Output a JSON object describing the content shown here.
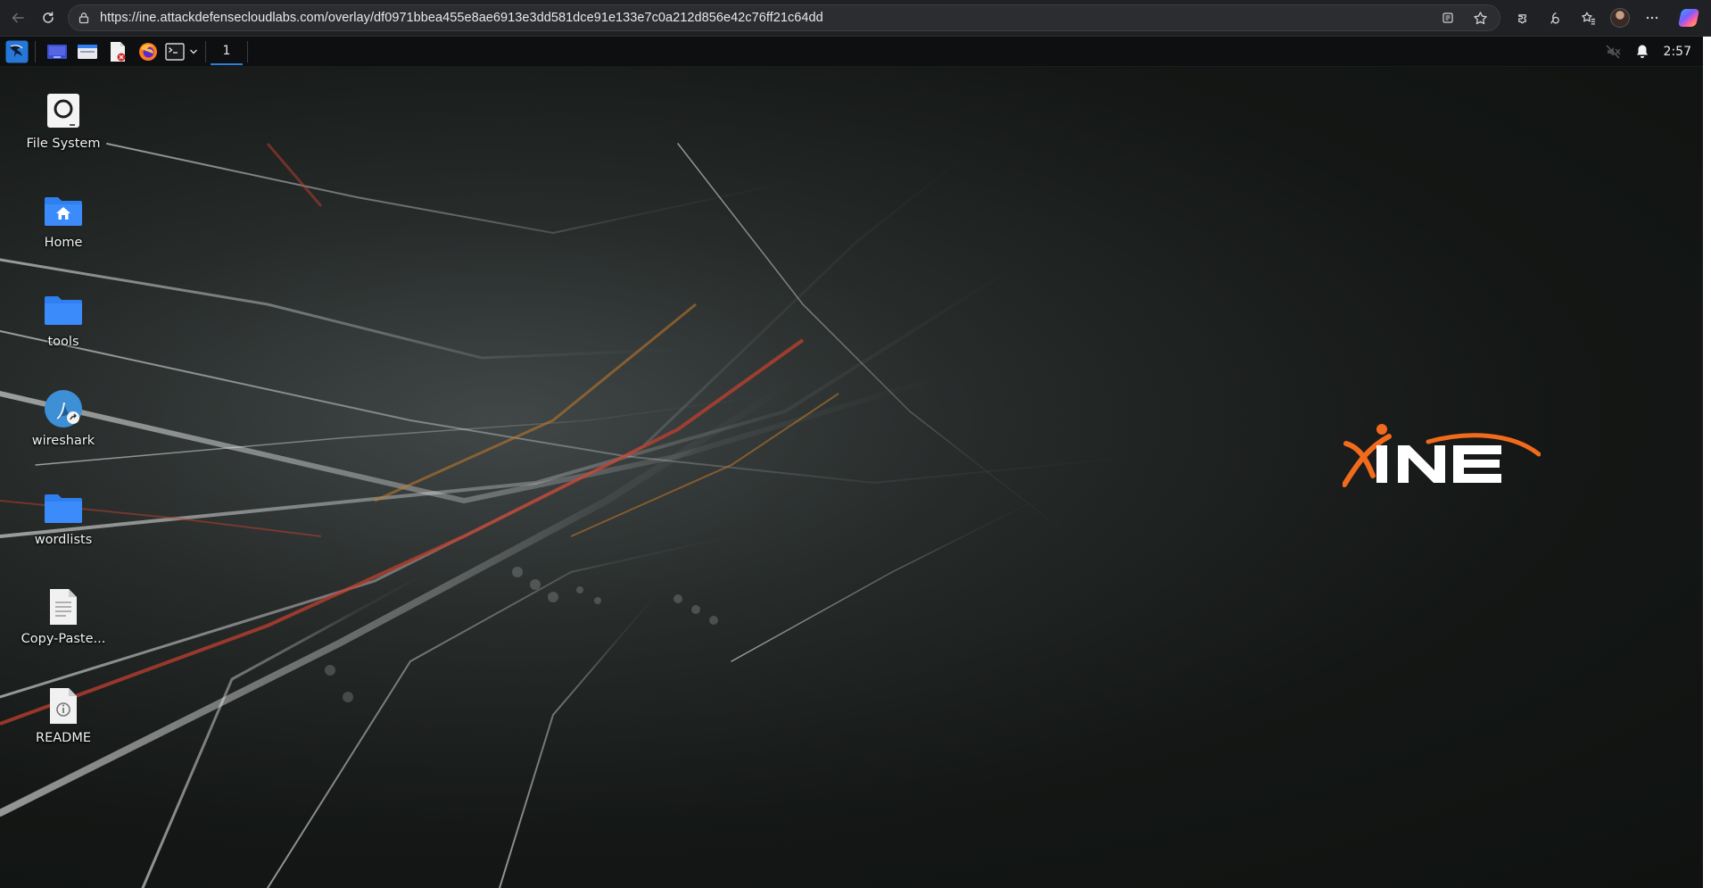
{
  "browser": {
    "url": "https://ine.attackdefensecloudlabs.com/overlay/df0971bbea455e8ae6913e3dd581dce91e133e7c0a212d856e42c76ff21c64dd",
    "icons": [
      "back-icon",
      "reload-icon",
      "lock-icon",
      "reading-view-icon",
      "favorite-star-icon",
      "extensions-icon",
      "browser-essentials-icon",
      "favorites-icon",
      "profile-avatar",
      "more-icon",
      "copilot-icon"
    ]
  },
  "panel": {
    "workspace": "1",
    "clock": "2:57",
    "launchers": [
      "kali-menu-icon",
      "show-desktop-icon",
      "file-manager-icon",
      "text-editor-icon",
      "firefox-icon",
      "terminal-icon"
    ]
  },
  "desktop": {
    "icons": [
      {
        "label": "File System",
        "icon": "drive-icon"
      },
      {
        "label": "Home",
        "icon": "home-folder-icon"
      },
      {
        "label": "tools",
        "icon": "folder-icon"
      },
      {
        "label": "wireshark",
        "icon": "wireshark-icon"
      },
      {
        "label": "wordlists",
        "icon": "folder-icon"
      },
      {
        "label": "Copy-Paste...",
        "icon": "text-file-icon"
      },
      {
        "label": "README",
        "icon": "info-file-icon"
      }
    ],
    "logo": "iNE",
    "colors": {
      "logo_orange": "#f26b1d",
      "folder_blue": "#2f7ff0",
      "accent_blue": "#2d7fd8"
    }
  }
}
